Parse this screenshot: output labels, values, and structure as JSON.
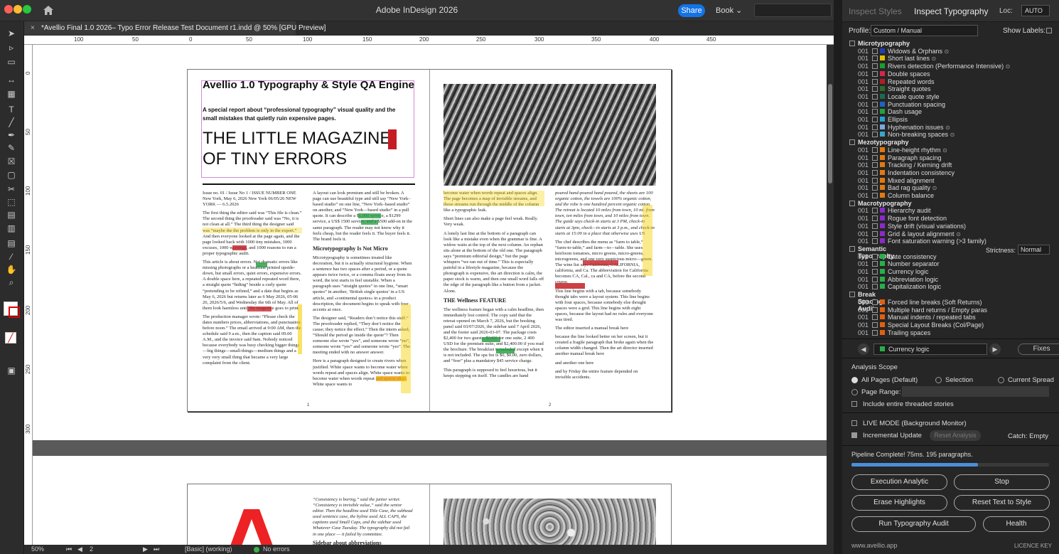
{
  "window": {
    "title": "Adobe InDesign 2026",
    "share_label": "Share",
    "book_label": "Book"
  },
  "document_tab": {
    "title": "*Avellio Final 1.0 2026– Typo Error Release Test Document r1.indd @ 50% [GPU Preview]",
    "close": "×"
  },
  "ruler_h_labels": [
    "100",
    "50",
    "0",
    "50",
    "100",
    "150",
    "200",
    "250",
    "300",
    "350",
    "400",
    "450"
  ],
  "ruler_v_labels": [
    "0",
    "50",
    "100",
    "150",
    "200",
    "250",
    "300"
  ],
  "page1": {
    "title": "Avellio 1.0 Typography & Style QA Engine",
    "subtitle": "A special report about “professional typography” visual quality and the small mistakes that quietly ruin expensive pages.",
    "headline": "THE LITTLE MAGAZINE OF TINY ERRORS",
    "col1": [
      "Issue no. 01 / Issue No 1 / ISSUE NUMBER ONE New York, May 6, 2026 New York 06/05/26 NEW YORK — 6.5.2026",
      "The first thing the editor said was “This file is clean.” The second thing the proofreader said was “No, it is not clean at all.” The third thing the designer said was “maybe the the problem is only in the export.” And then everyone looked at the page again, and the page looked back with 1000 tiny mistakes, 1000 excuses, 1000 warnings, and 1000 reasons to run a proper typographic audit.",
      "This article is about errors. Not dramatic errors like missing photographs or a headline printed upside-down, but small errors, quiet errors, expensive errors. A double space here, a repeated repeated word there, a straight quote “hiding” beside a curly quote “pretending to be refined,” and a date that begins as May 6, 2026 but returns later as 6 May 2026, 05-06 26, 2026/5/6, and Wednesday the 6th of May. All of them look harmless until the magazine goes to print.",
      "The production manager wrote: “Please check the dates numbers prices, abbreviations, and punctuation before noon.” The email arrived at 9:00 AM, then the schedule said 9 a.m., then the caption said 09.00 A.M., and the invoice said 9am. Nobody noticed because everybody was busy checking bigger things—big things—small-things—medium things and a very very small thing that became a very large complaint from the client."
    ],
    "col2": [
      "A layout can look premium and still be broken. A page can use beautiful type and still say “New York–based studio” on one line, “New York–based studio” on another, and “New York—based studio” in a pull quote. It can describe a $1,000 service, a $1299 service, a US$ 1500 service, and a $500 add-on in the same paragraph. The reader may not know why it feels cheap, but the reader feels it. The buyer feels it. The brand feels it.",
      "Microtypography Is Not Micro",
      "Microtypography is sometimes treated like decoration, but it is actually structural hygiene. When a sentence has two spaces after a period, or a quote appears twice twice, or a comma floats away from its word, the text starts to feel unstable. When a paragraph uses “straight quotes” in one line, “smart quotes” in another, ‘British single quotes’ in a US article, and «continental quotes» in a product description, the document begins to speak with four accents at once.",
      "The designer said, “Readers don’t notice this stuff.” The proofreader replied, “They don’t notice the cause; they notice the effect.” Then the intern asked, “Should the period go inside the quote”? Then someone else wrote “yes”, and someone wrote “no”, someone wrote “yes” and someone wrote “yes”. The meeting ended with no answer answer.",
      "Here is a paragraph designed to create rivers when justified. White space wants to become water when words repeat and spaces align. White space wants to become water when words repeat and spaces align. White space wants to"
    ],
    "page_number": "1"
  },
  "page2": {
    "col1": [
      "become water when words repeat and spaces align. The page becomes a map of invisible streams, and those streams run through the middle of the column like a typographic leak.",
      "Short lines can also make a page feel weak. Really. Very weak.",
      "A lonely last line at the bottom of a paragraph can look like a mistake even when the grammar is fine. A widow waits at the top of the next column. An orphan sits alone at the bottom of the old one. The paragraph says “premium editorial design,” but the page whispers “we ran out of time.” This is especially painful in a lifestyle magazine, because the photograph is expensive, the art direction is calm, the paper stock is warm, and then one small word falls off the edge of the paragraph like a button from a jacket. Alone.",
      "THE Wellness FEATURE",
      "The wellness feature began with a calm headline, then immediately lost control. The copy said that the retreat opened on March 7, 2026, but the booking panel said 03/07/2026, the sidebar said 7 April 2026, and the footer said 2026-03-07. The package costs $2,400 for two guests, $2400 for one suite, 2 400 USD for the premium suite, and $2,400.00 if you read the brochure. The breakfast is included except when it is not included. The spa fee is $0, $0.00, zero dollars, and “free” plus a mandatory $45 service charge.",
      "This paragraph is supposed to feel luxurious, but it keeps stepping on itself. The candles are hand"
    ],
    "col2": [
      "poured hand-poured hand poured, the sheets are 100 organic cotton, the towels are 100% organic cotton, and the robe is one hundred percent organic cotton. The retreat is located 10 miles from town, 10 mi. from town, ten miles from town, and 10 miles from town. The guide says check-in starts at 3 PM, check-in starts at 3pm, check—in starts at 3 p.m., and check-in starts at 15:00 in a place that otherwise uses US",
      "The chef describes the menu as “farm to table,” “farm-to-table,” and farm—to—table. She uses heirloom tomatoes, micro greens, micro-greens, microgreens, and one very suspicious micro—green. The wine list says California, CALIFORNIA, california, and Ca. The abbreviation for California becomes CA, Cal., ca and CA, before the second course.",
      "This line begins with a tab, because somebody thought tabs were a layout system. This line begins with four spaces, because somebody else thought spaces were a grid. This line begins with eight spaces, because the layout had no rules and everyone was tired.",
      "The editor inserted a manual break here",
      "because the line looked better on her screen, but it created a fragile paragraph that broke again when the column width changed. Then the art director inserted another manual break here",
      "and another one here",
      "and by Friday the entire feature depended on invisible accidents."
    ],
    "page_number": "2"
  },
  "spread2": {
    "col2": [
      "“Consistency is boring,” said the junior writer. “Consistency is invisible value,” said the senior editor. Then the headline used Title Case, the subhead used sentence case, the byline used ALL CAPS, the captions used Small Caps, and the sidebar used Whatever Case Tuesday. The typography did not fail in one place — it failed by committee.",
      "Sidebar about abbreviations"
    ]
  },
  "status": {
    "zoom": "50%",
    "page": "2",
    "style": "[Basic] (working)",
    "preflight": "No errors"
  },
  "panel": {
    "tab_inactive": "Inspect Styles",
    "tab_active": "Inspect Typography",
    "loc_label": "Loc:",
    "loc_value": "AUTO",
    "profile_label": "Profile:",
    "profile_value": "Custom / Manual",
    "show_labels": "Show Labels:",
    "groups": [
      {
        "name": "Microtypography",
        "items": [
          {
            "n": "001",
            "color": "#1e3fb0",
            "label": "Widows & Orphans",
            "info": true
          },
          {
            "n": "001",
            "color": "#e0c000",
            "label": "Short last lines",
            "info": true
          },
          {
            "n": "001",
            "color": "#1a9e2e",
            "label": "Rivers detection (Performance Intensive)",
            "info": true
          },
          {
            "n": "001",
            "color": "#d7264e",
            "label": "Double spaces",
            "info": false
          },
          {
            "n": "001",
            "color": "#b01e24",
            "label": "Repeated words",
            "info": false
          },
          {
            "n": "001",
            "color": "#2e6b2e",
            "label": "Straight quotes",
            "info": false
          },
          {
            "n": "001",
            "color": "#1b6b50",
            "label": "Locale quote style",
            "info": false
          },
          {
            "n": "001",
            "color": "#1d63c6",
            "label": "Punctuation spacing",
            "info": false
          },
          {
            "n": "001",
            "color": "#1fa33b",
            "label": "Dash usage",
            "info": false
          },
          {
            "n": "001",
            "color": "#26a0d6",
            "label": "Ellipsis",
            "info": false
          },
          {
            "n": "001",
            "color": "#7aa7e0",
            "label": "Hyphenation issues",
            "info": true
          },
          {
            "n": "001",
            "color": "#3aa6c9",
            "label": "Non-breaking spaces",
            "info": true
          }
        ]
      },
      {
        "name": "Mezotypography",
        "items": [
          {
            "n": "001",
            "color": "#e07a10",
            "label": "Line-height rhythm",
            "info": true
          },
          {
            "n": "001",
            "color": "#e07a10",
            "label": "Paragraph spacing",
            "info": false
          },
          {
            "n": "001",
            "color": "#e07a10",
            "label": "Tracking / Kerning drift",
            "info": false
          },
          {
            "n": "001",
            "color": "#e07a10",
            "label": "Indentation consistency",
            "info": false
          },
          {
            "n": "001",
            "color": "#e07a10",
            "label": "Mixed alignment",
            "info": false
          },
          {
            "n": "001",
            "color": "#e07a10",
            "label": "Bad rag quality",
            "info": true
          },
          {
            "n": "001",
            "color": "#e07a10",
            "label": "Column balance",
            "info": false
          }
        ]
      },
      {
        "name": "Macrotypography",
        "items": [
          {
            "n": "001",
            "color": "#8a2bc9",
            "label": "Hierarchy audit",
            "info": false
          },
          {
            "n": "001",
            "color": "#8a2bc9",
            "label": "Rogue font detection",
            "info": false
          },
          {
            "n": "001",
            "color": "#8a2bc9",
            "label": "Style drift (visual variations)",
            "info": false
          },
          {
            "n": "001",
            "color": "#8a2bc9",
            "label": "Grid & layout alignment",
            "info": true
          },
          {
            "n": "001",
            "color": "#8a2bc9",
            "label": "Font saturation warning (>3 family)",
            "info": false
          }
        ]
      },
      {
        "name": "Semantic Typography",
        "items": [
          {
            "n": "001",
            "color": "#27b04a",
            "label": "Date consistency",
            "info": false
          },
          {
            "n": "001",
            "color": "#27b04a",
            "label": "Number separator",
            "info": false
          },
          {
            "n": "001",
            "color": "#27b04a",
            "label": "Currency logic",
            "info": false
          },
          {
            "n": "001",
            "color": "#27b04a",
            "label": "Abbreviation logic",
            "info": false
          },
          {
            "n": "001",
            "color": "#27b04a",
            "label": "Capitalization logic",
            "info": false
          }
        ]
      },
      {
        "name": "Break Spacing Audit",
        "items": [
          {
            "n": "001",
            "color": "#e06010",
            "label": "Forced line breaks (Soft Returns)",
            "info": false
          },
          {
            "n": "001",
            "color": "#e06010",
            "label": "Multiple hard returns / Empty paras",
            "info": false
          },
          {
            "n": "001",
            "color": "#e06010",
            "label": "Manual indents / repeated tabs",
            "info": false
          },
          {
            "n": "001",
            "color": "#e06010",
            "label": "Special Layout Breaks (Col/Page)",
            "info": false
          },
          {
            "n": "001",
            "color": "#e06010",
            "label": "Trailing spaces",
            "info": false
          }
        ]
      }
    ],
    "strictness_label": "Strictness:",
    "strictness_value": "Normal",
    "nav_selected": "Currency logic",
    "fixes_label": "Fixes",
    "scope_title": "Analysis Scope",
    "scope_all": "All Pages (Default)",
    "scope_selection": "Selection",
    "scope_spread": "Current Spread",
    "scope_range": "Page Range:",
    "scope_threaded": "Include entire threaded stories",
    "live_mode": "LIVE MODE (Background Monitor)",
    "incremental": "Incremental Update",
    "reset_analysis": "Reset Analysis",
    "catch": "Catch: Empty",
    "pipeline": "Pipeline Complete! 75ms. 195 paragraphs.",
    "progress": 0.64,
    "btn_execution": "Execution Analytic",
    "btn_stop": "Stop",
    "btn_erase": "Erase Highlights",
    "btn_reset_text": "Reset Text to Style",
    "btn_run": "Run Typography Audit",
    "btn_health": "Health",
    "footer_site": "www.avellio.app",
    "footer_licence": "LICENCE KEY"
  }
}
